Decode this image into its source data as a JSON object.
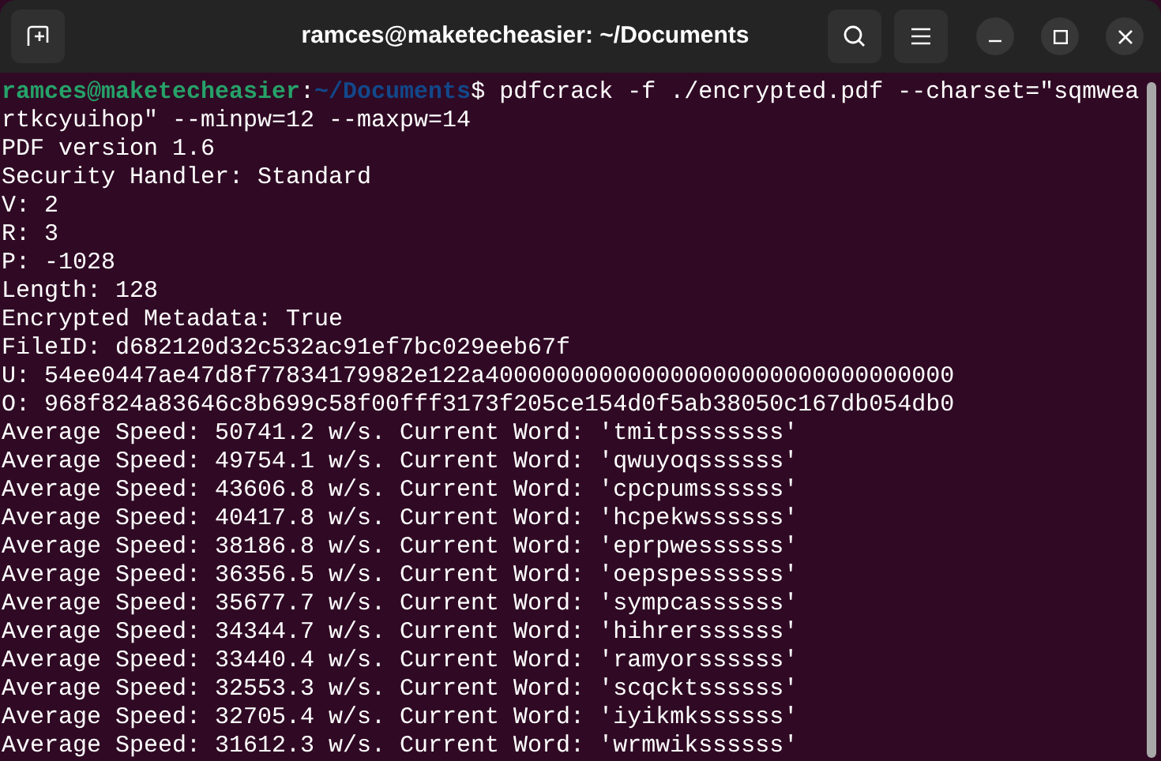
{
  "window": {
    "title": "ramces@maketecheasier: ~/Documents"
  },
  "prompt": {
    "user_host": "ramces@maketecheasier",
    "separator": ":",
    "path": "~/Documents",
    "symbol": "$",
    "command": "pdfcrack -f ./encrypted.pdf --charset=\"sqmwea"
  },
  "output_lines": [
    "rtkcyuihop\" --minpw=12 --maxpw=14",
    "PDF version 1.6",
    "Security Handler: Standard",
    "V: 2",
    "R: 3",
    "P: -1028",
    "Length: 128",
    "Encrypted Metadata: True",
    "FileID: d682120d32c532ac91ef7bc029eeb67f",
    "U: 54ee0447ae47d8f77834179982e122a400000000000000000000000000000000",
    "O: 968f824a83646c8b699c58f00fff3173f205ce154d0f5ab38050c167db054db0",
    "Average Speed: 50741.2 w/s. Current Word: 'tmitpsssssss'",
    "Average Speed: 49754.1 w/s. Current Word: 'qwuyoqssssss'",
    "Average Speed: 43606.8 w/s. Current Word: 'cpcpumssssss'",
    "Average Speed: 40417.8 w/s. Current Word: 'hcpekwssssss'",
    "Average Speed: 38186.8 w/s. Current Word: 'eprpwessssss'",
    "Average Speed: 36356.5 w/s. Current Word: 'oepspessssss'",
    "Average Speed: 35677.7 w/s. Current Word: 'sympcassssss'",
    "Average Speed: 34344.7 w/s. Current Word: 'hihrerssssss'",
    "Average Speed: 33440.4 w/s. Current Word: 'ramyorssssss'",
    "Average Speed: 32553.3 w/s. Current Word: 'scqcktssssss'",
    "Average Speed: 32705.4 w/s. Current Word: 'iyikmkssssss'",
    "Average Speed: 31612.3 w/s. Current Word: 'wrmwikssssss'"
  ]
}
